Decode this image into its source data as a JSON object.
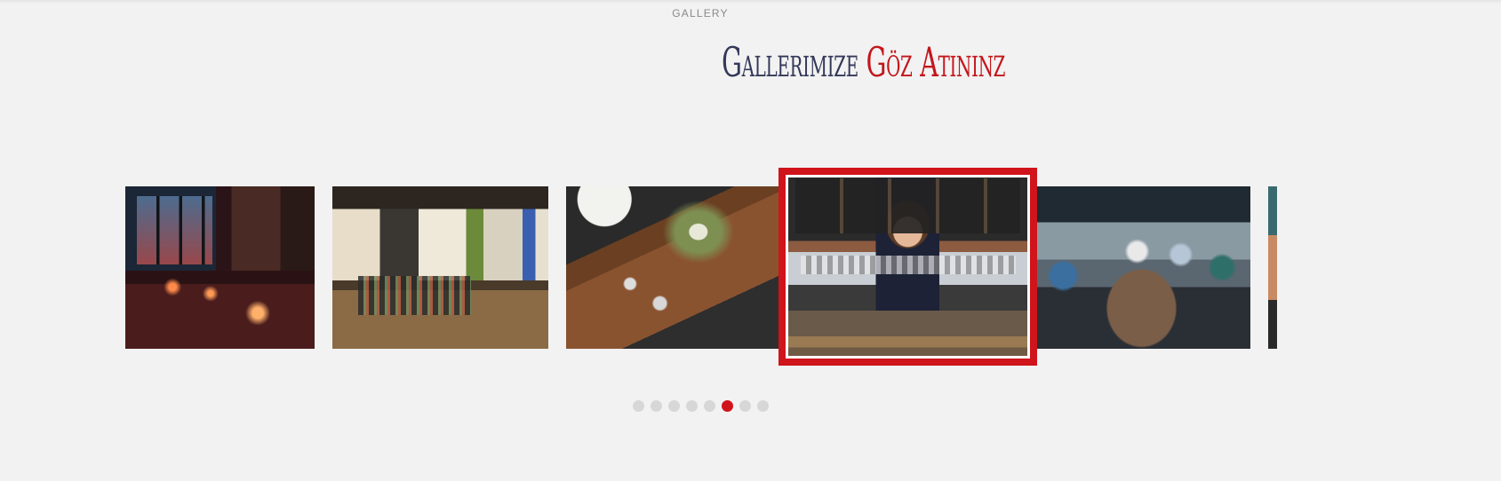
{
  "section": {
    "label": "GALLERY",
    "title_part1": "Gallerimize",
    "title_part2": "Göz Atininz"
  },
  "colors": {
    "background": "#f2f2f2",
    "title_dark": "#34385a",
    "accent_red": "#d0141b",
    "dot_inactive": "#d7d7d7"
  },
  "carousel": {
    "slides": [
      {
        "description": "bar interior with wine glasses",
        "active": false
      },
      {
        "description": "cafe interior with shelves",
        "active": false
      },
      {
        "description": "overhead wooden table with flowers",
        "active": false
      },
      {
        "description": "bartender serving beer flight",
        "active": true
      },
      {
        "description": "people on patio",
        "active": false
      },
      {
        "description": "partially visible photo",
        "active": false
      }
    ],
    "page_count": 8,
    "active_page": 6
  }
}
